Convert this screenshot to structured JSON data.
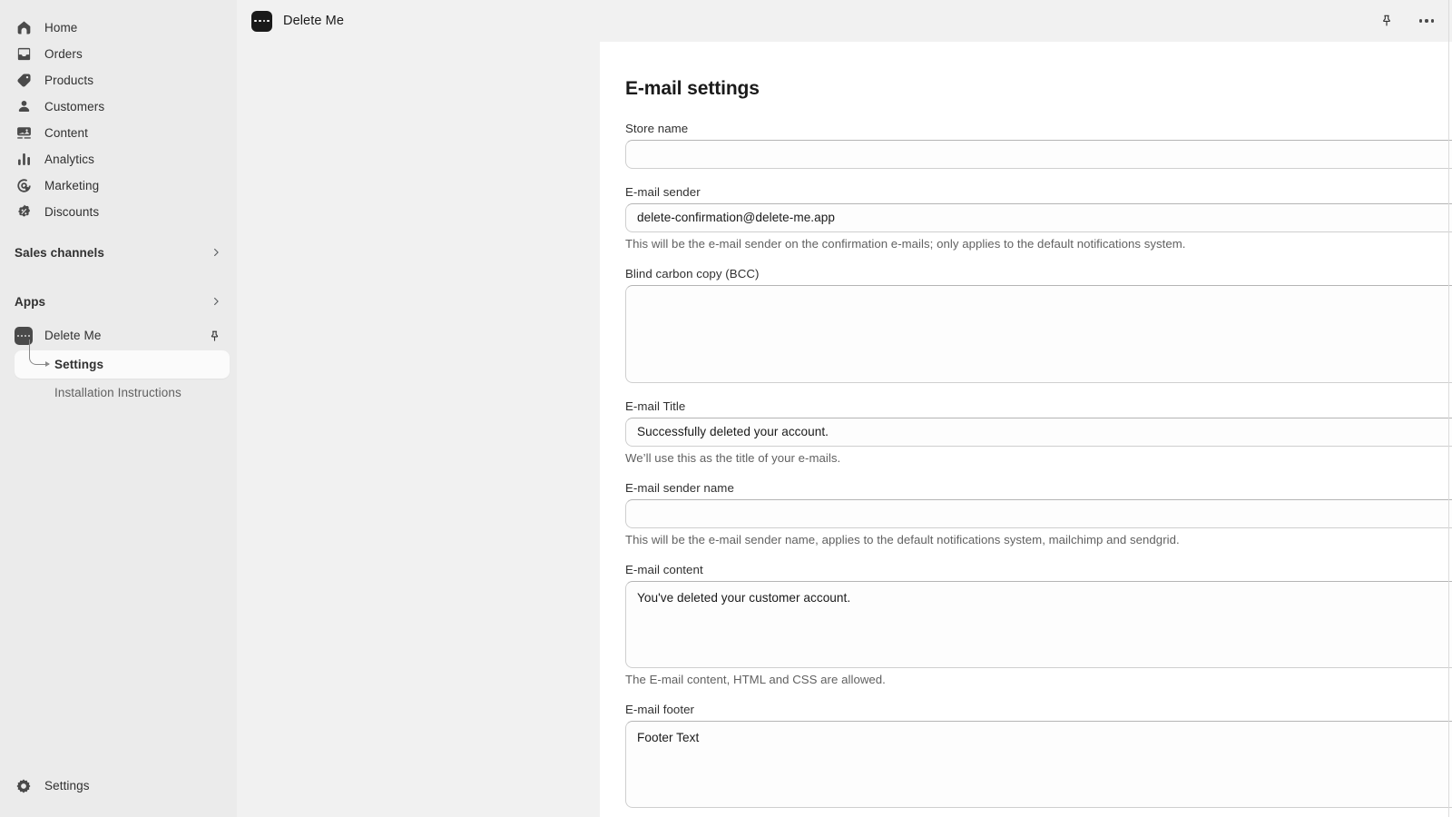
{
  "sidebar": {
    "primary_nav": [
      {
        "label": "Home",
        "icon": "home-icon"
      },
      {
        "label": "Orders",
        "icon": "orders-inbox-icon"
      },
      {
        "label": "Products",
        "icon": "products-tag-icon"
      },
      {
        "label": "Customers",
        "icon": "customers-person-icon"
      },
      {
        "label": "Content",
        "icon": "content-image-icon"
      },
      {
        "label": "Analytics",
        "icon": "analytics-bars-icon"
      },
      {
        "label": "Marketing",
        "icon": "marketing-target-icon"
      },
      {
        "label": "Discounts",
        "icon": "discounts-badge-icon"
      }
    ],
    "sections": [
      {
        "label": "Sales channels",
        "icon": "chevron-right-icon"
      },
      {
        "label": "Apps",
        "icon": "chevron-right-icon"
      }
    ],
    "app": {
      "name": "Delete Me",
      "icon": "app-dots-icon",
      "pin_icon": "pin-icon",
      "subitems": [
        {
          "label": "Settings",
          "active": true
        },
        {
          "label": "Installation Instructions",
          "active": false
        }
      ]
    },
    "bottom": {
      "label": "Settings",
      "icon": "gear-icon"
    }
  },
  "topbar": {
    "app_icon": "app-dots-icon",
    "title": "Delete Me",
    "pin_icon": "pin-icon",
    "more_icon": "more-horizontal-icon"
  },
  "page": {
    "title": "E-mail settings",
    "fields": {
      "store_name": {
        "label": "Store name",
        "value": "",
        "placeholder": ""
      },
      "email_sender": {
        "label": "E-mail sender",
        "value": "delete-confirmation@delete-me.app",
        "helper": "This will be the e-mail sender on the confirmation e-mails; only applies to the default notifications system."
      },
      "bcc": {
        "label": "Blind carbon copy (BCC)",
        "value": ""
      },
      "email_title": {
        "label": "E-mail Title",
        "value": "Successfully deleted your account.",
        "helper": "We’ll use this as the title of your e-mails."
      },
      "email_sender_name": {
        "label": "E-mail sender name",
        "value": "",
        "helper": "This will be the e-mail sender name, applies to the default notifications system, mailchimp and sendgrid."
      },
      "email_content": {
        "label": "E-mail content",
        "value": "You've deleted your customer account.",
        "helper": "The E-mail content, HTML and CSS are allowed."
      },
      "email_footer": {
        "label": "E-mail footer",
        "value": "Footer Text"
      }
    }
  },
  "colors": {
    "sidebar_bg": "#ebebeb",
    "app_bg": "#f1f1f1",
    "card_bg": "#ffffff",
    "text_primary": "#1a1a1a",
    "text_secondary": "#616161",
    "border": "#cfcfcf",
    "active_item_bg": "#fbfbfb"
  }
}
